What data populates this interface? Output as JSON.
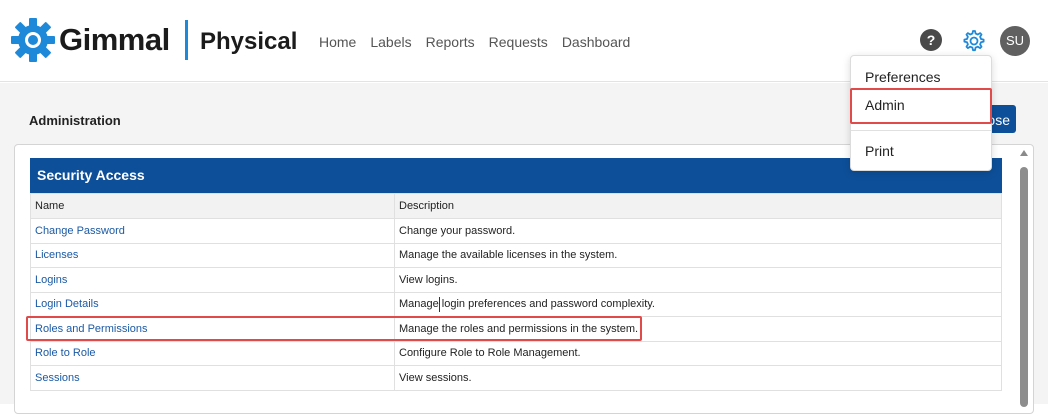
{
  "header": {
    "brand": "Gimmal",
    "product": "Physical",
    "nav": [
      "Home",
      "Labels",
      "Reports",
      "Requests",
      "Dashboard"
    ],
    "help": "?",
    "avatar": "SU"
  },
  "page": {
    "title": "Administration",
    "close_label": "ose"
  },
  "section": {
    "title": "Security Access",
    "columns": [
      "Name",
      "Description"
    ],
    "rows": [
      {
        "name": "Change Password",
        "description": "Change your password."
      },
      {
        "name": "Licenses",
        "description": "Manage the available licenses in the system."
      },
      {
        "name": "Logins",
        "description": "View logins."
      },
      {
        "name": "Login Details",
        "description": "Manage login preferences and password complexity."
      },
      {
        "name": "Roles and Permissions",
        "description": "Manage the roles and permissions in the system."
      },
      {
        "name": "Role to Role",
        "description": "Configure Role to Role Management."
      },
      {
        "name": "Sessions",
        "description": "View sessions."
      }
    ]
  },
  "dropdown": {
    "items": [
      "Preferences",
      "Admin",
      "Print"
    ]
  },
  "colors": {
    "brand_blue": "#0d4f99",
    "accent_blue": "#1e88d9",
    "link": "#1b5aa5",
    "highlight_red": "#e04a4a"
  }
}
